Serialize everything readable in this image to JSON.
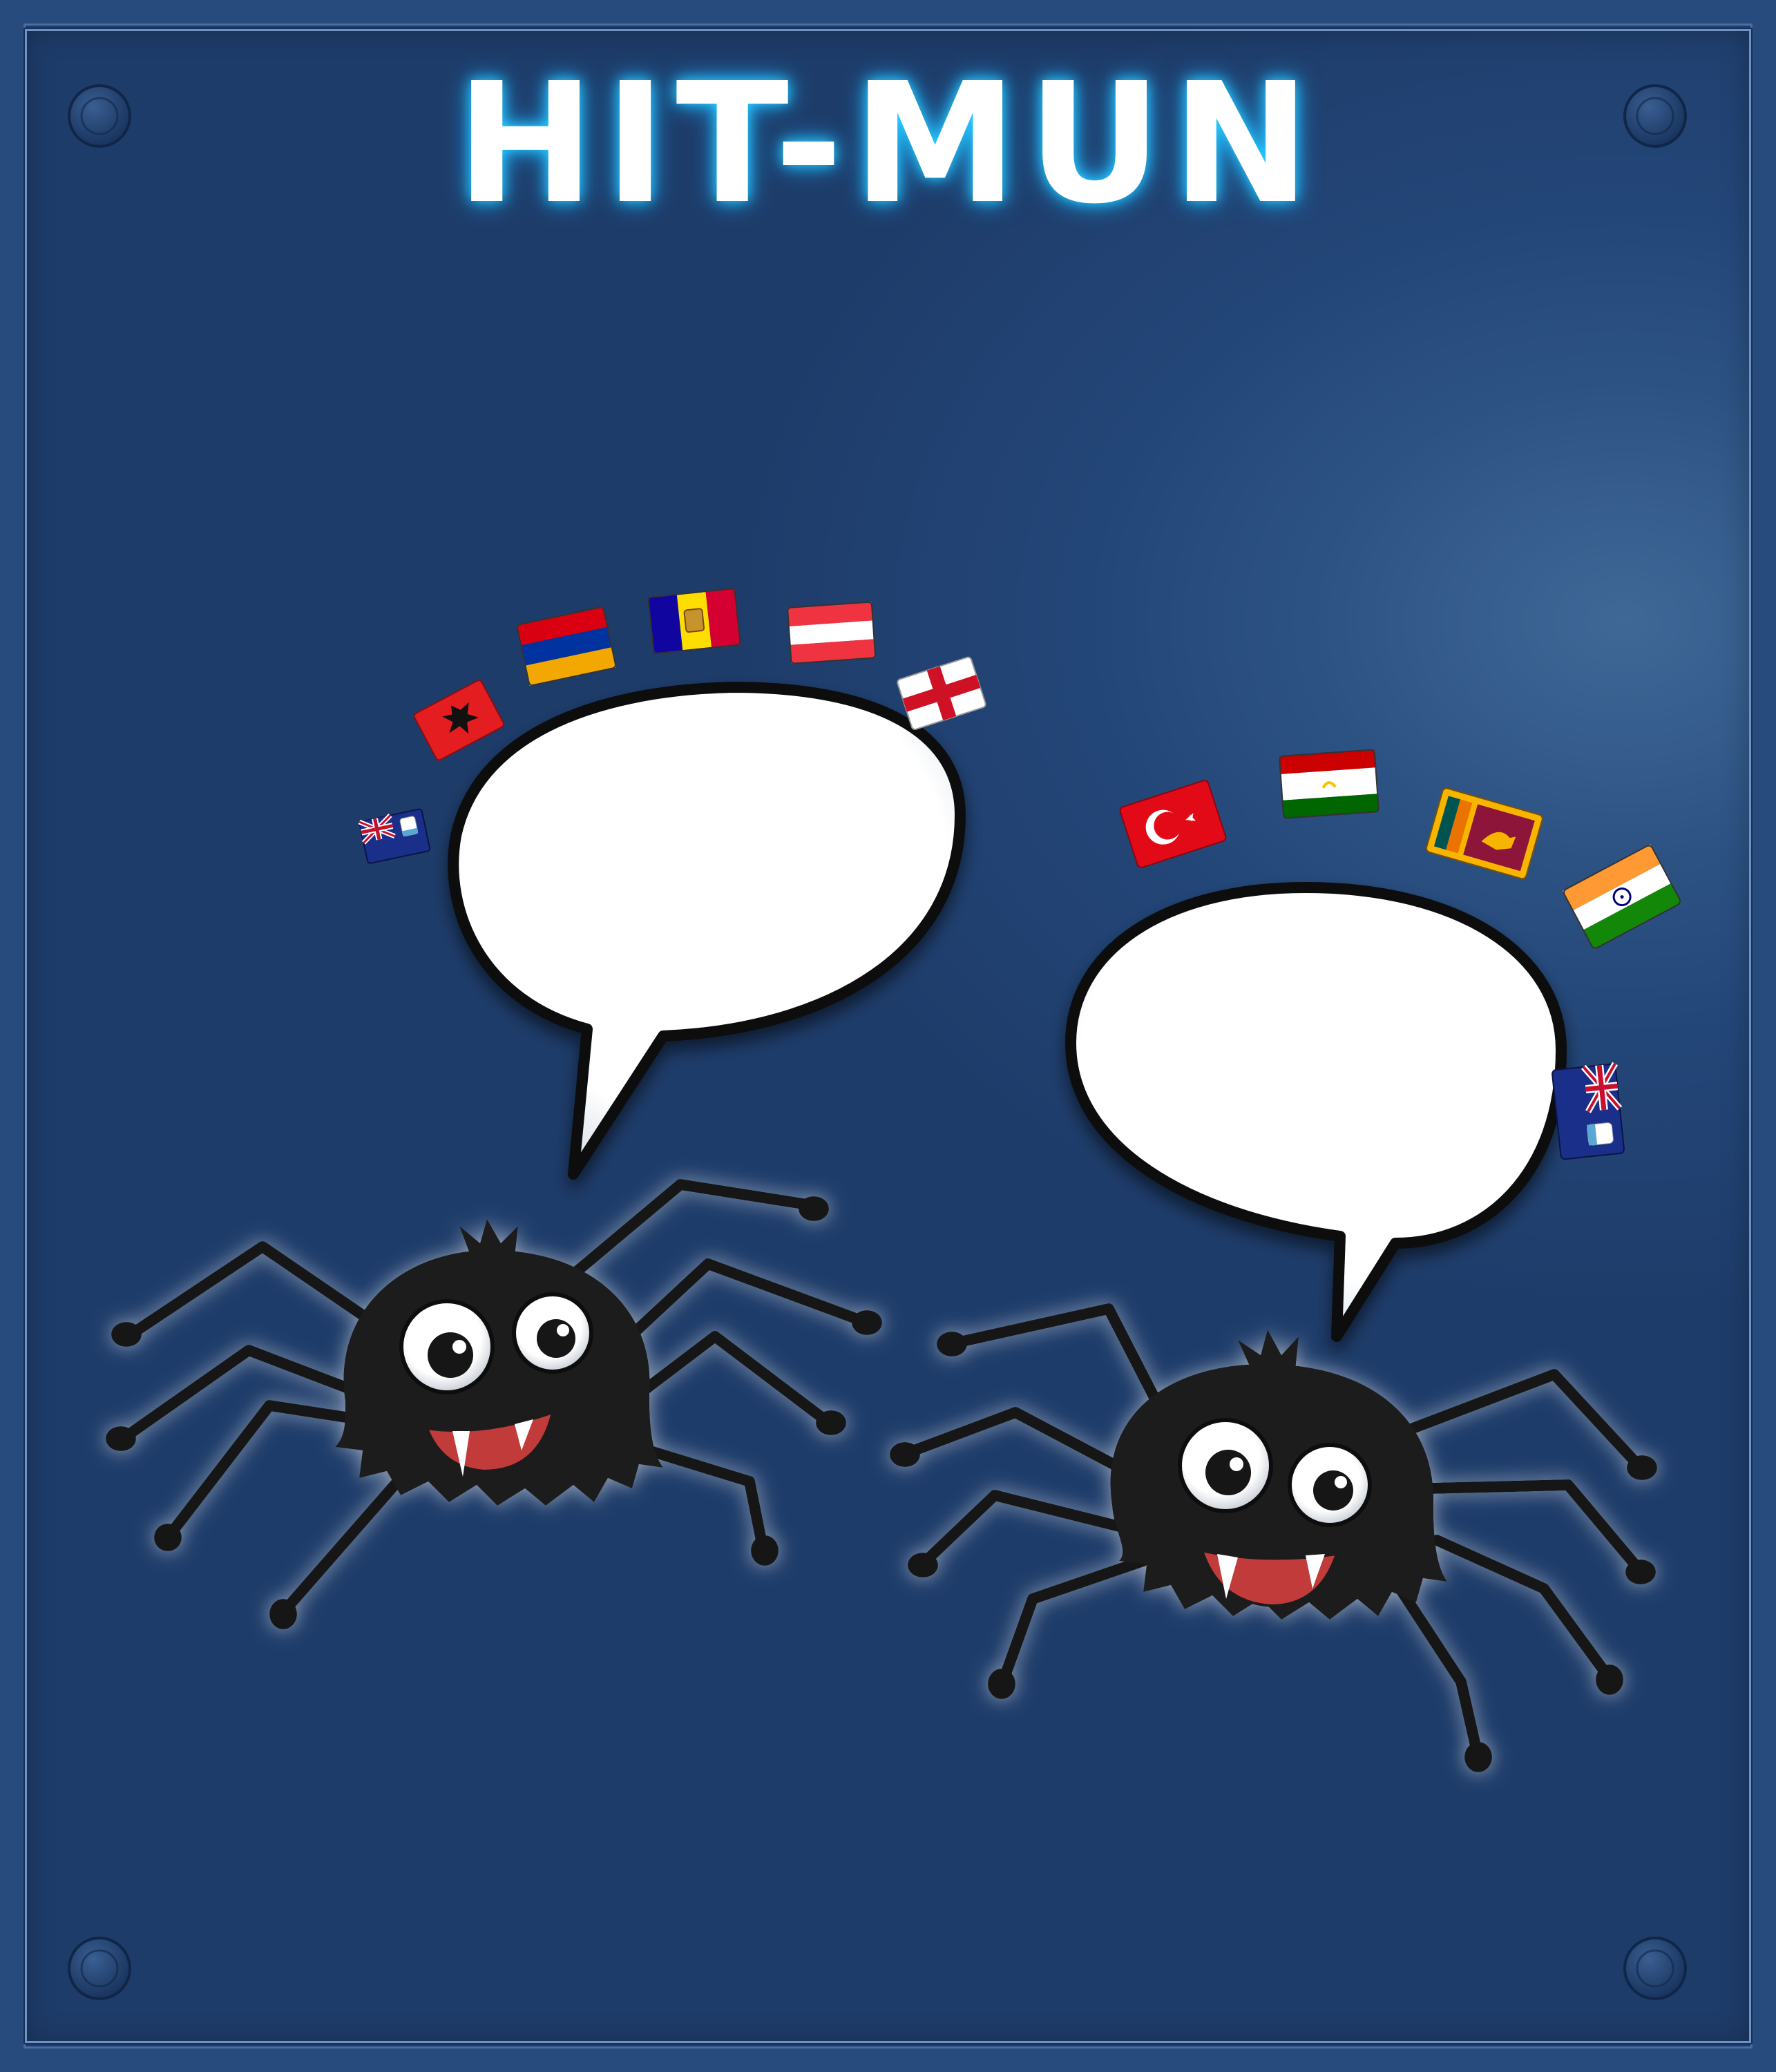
{
  "poster": {
    "title": "HIT-MUN"
  },
  "colors": {
    "background": "#2b5080",
    "title_glow": "#2ad0ff",
    "spider_body": "#1b1a1c",
    "mouth": "#c23a3a"
  },
  "icons": {
    "corner_screws": "screw-icon",
    "left_flags": [
      "anguilla-flag-icon",
      "albania-flag-icon",
      "armenia-flag-icon",
      "andorra-flag-icon",
      "austria-flag-icon",
      "england-flag-icon"
    ],
    "right_flags": [
      "turkey-flag-icon",
      "tajikistan-flag-icon",
      "sri-lanka-flag-icon",
      "india-flag-icon",
      "anguilla-flag-icon"
    ],
    "characters": [
      "spider-icon",
      "spider-icon"
    ],
    "bubbles": [
      "speech-bubble-icon",
      "speech-bubble-icon"
    ]
  }
}
